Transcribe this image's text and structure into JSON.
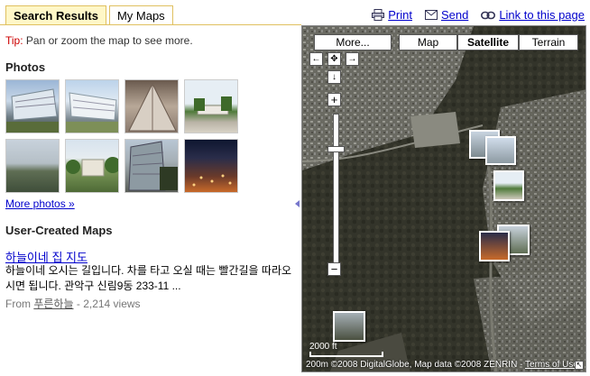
{
  "tabs": [
    {
      "label": "Search Results",
      "active": true
    },
    {
      "label": "My Maps",
      "active": false
    }
  ],
  "toplinks": {
    "print": "Print",
    "send": "Send",
    "link": "Link to this page"
  },
  "tip": {
    "label": "Tip:",
    "text": "Pan or zoom the map to see more."
  },
  "photos": {
    "title": "Photos",
    "more": "More photos »"
  },
  "user_maps": {
    "title": "User-Created Maps",
    "item_title": "하늘이네 집 지도",
    "item_desc": "하늘이네 오시는 길입니다. 차를 타고 오실 때는 빨간길을 따라오시면 됩니다. 관악구 신림9동 233-11 ...",
    "from_label": "From",
    "author": "푸른하늘",
    "views": "- 2,214 views"
  },
  "map": {
    "more_btn": "More...",
    "types": [
      "Map",
      "Satellite",
      "Terrain"
    ],
    "selected_type": "Satellite",
    "scale_label": "2000 ft",
    "scale_label2": "200m",
    "copyright": "©2008 DigitalGlobe, Map data ©2008 ZENRIN - ",
    "terms": "Terms of Use"
  },
  "colors": {
    "tab_border": "#e0c060",
    "tab_active_bg": "#fff7c7",
    "link": "#0000cc",
    "tip_label": "#cc0000"
  }
}
